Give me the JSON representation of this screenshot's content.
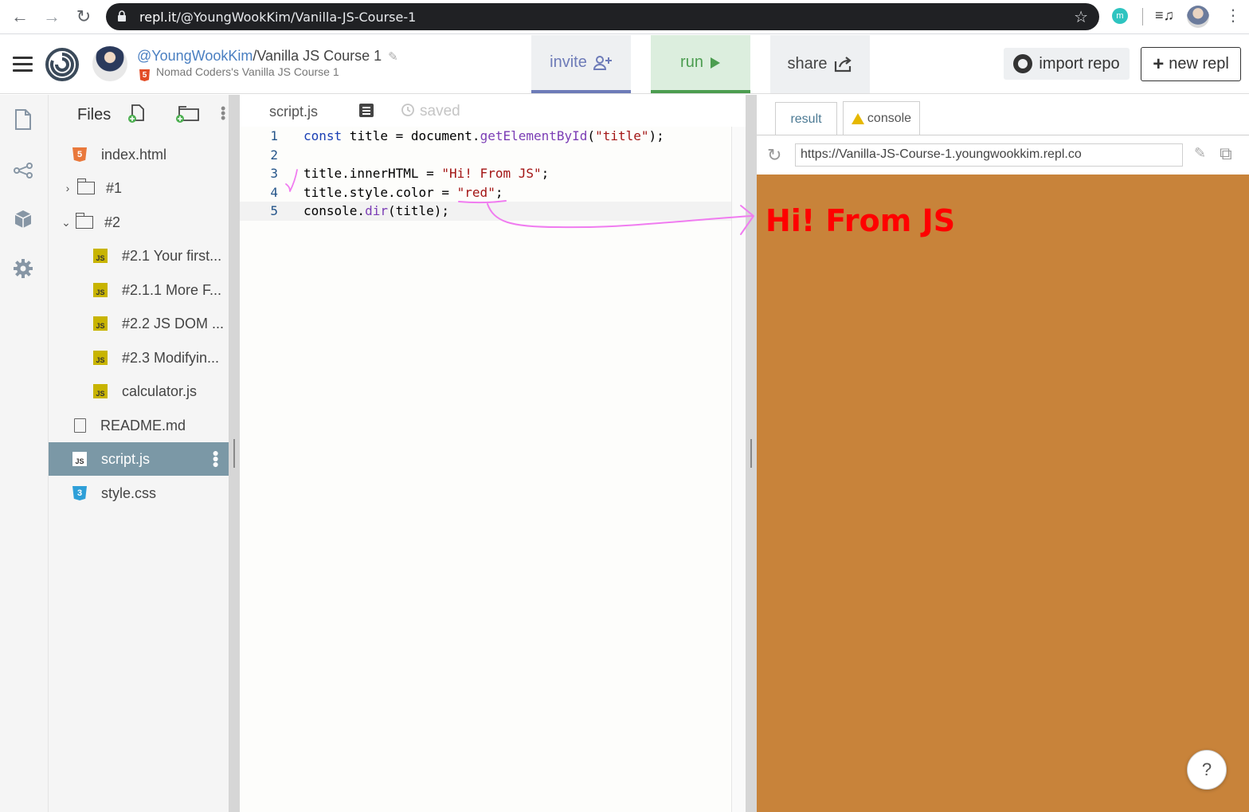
{
  "browser": {
    "url_host": "repl.it",
    "url_path": "/@YoungWookKim/Vanilla-JS-Course-1",
    "extension_label": "m"
  },
  "header": {
    "owner": "@YoungWookKim",
    "separator": "/",
    "repl_name": "Vanilla JS Course 1",
    "subtitle": "Nomad Coders's Vanilla JS Course 1",
    "html5_glyph": "5",
    "invite_label": "invite",
    "run_label": "run",
    "share_label": "share",
    "import_label": "import repo",
    "new_repl_label": "new repl"
  },
  "files": {
    "title": "Files",
    "items": [
      {
        "label": "index.html",
        "type": "html",
        "glyph": "5"
      },
      {
        "label": "#1",
        "type": "folder",
        "state": "collapsed"
      },
      {
        "label": "#2",
        "type": "folder",
        "state": "expanded"
      },
      {
        "label": "#2.1 Your first...",
        "type": "js",
        "glyph": "JS"
      },
      {
        "label": "#2.1.1 More F...",
        "type": "js",
        "glyph": "JS"
      },
      {
        "label": "#2.2 JS DOM ...",
        "type": "js",
        "glyph": "JS"
      },
      {
        "label": "#2.3 Modifyin...",
        "type": "js",
        "glyph": "JS"
      },
      {
        "label": "calculator.js",
        "type": "js",
        "glyph": "JS"
      },
      {
        "label": "README.md",
        "type": "doc"
      },
      {
        "label": "script.js",
        "type": "js",
        "glyph": "JS",
        "selected": true
      },
      {
        "label": "style.css",
        "type": "css",
        "glyph": "3"
      }
    ]
  },
  "editor": {
    "tab_name": "script.js",
    "save_status": "saved",
    "active_line": 5,
    "lines": [
      {
        "num": "1",
        "parts": [
          [
            "kw",
            "const"
          ],
          [
            "p",
            " title = document."
          ],
          [
            "fn",
            "getElementById"
          ],
          [
            "p",
            "("
          ],
          [
            "str",
            "\"title\""
          ],
          [
            "p",
            ");"
          ]
        ]
      },
      {
        "num": "2",
        "parts": []
      },
      {
        "num": "3",
        "parts": [
          [
            "p",
            "title.innerHTML = "
          ],
          [
            "str",
            "\"Hi! From JS\""
          ],
          [
            "p",
            ";"
          ]
        ]
      },
      {
        "num": "4",
        "parts": [
          [
            "p",
            "title.style.color = "
          ],
          [
            "str",
            "\"red\""
          ],
          [
            "p",
            ";"
          ]
        ]
      },
      {
        "num": "5",
        "parts": [
          [
            "p",
            "console."
          ],
          [
            "fn",
            "dir"
          ],
          [
            "p",
            "(title);"
          ]
        ]
      }
    ]
  },
  "result": {
    "tab_result": "result",
    "tab_console": "console",
    "url": "https://Vanilla-JS-Course-1.youngwookkim.repl.co",
    "heading": "Hi! From JS",
    "heading_color": "#ff0000",
    "background": "#c8833a",
    "help_label": "?"
  },
  "colors": {
    "annotation": "#f07cf0",
    "invite": "#6d7bb8",
    "run": "#4c9d50",
    "selected_file": "#7b98a6"
  }
}
